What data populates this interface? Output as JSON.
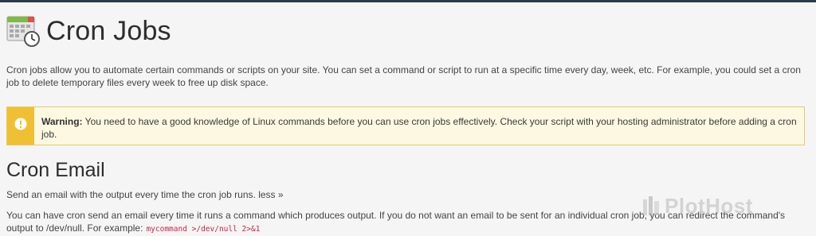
{
  "header": {
    "title": "Cron Jobs",
    "icon": "calendar-clock-icon"
  },
  "intro": {
    "text": "Cron jobs allow you to automate certain commands or scripts on your site. You can set a command or script to run at a specific time every day, week, etc. For example, you could set a cron job to delete temporary files every week to free up disk space."
  },
  "warning": {
    "icon": "exclamation-icon",
    "label": "Warning:",
    "text": " You need to have a good knowledge of Linux commands before you can use cron jobs effectively. Check your script with your hosting administrator before adding a cron job."
  },
  "email": {
    "title": "Cron Email",
    "description": "Send an email with the output every time the cron job runs.",
    "more_link": "less »",
    "note": "You can have cron send an email every time it runs a command which produces output. If you do not want an email to be sent for an individual cron job, you can redirect the command's output to /dev/null. For example:",
    "example_code": "mycommand >/dev/null 2>&1"
  },
  "watermark": {
    "text": "PlotHost"
  },
  "colors": {
    "warning_accent": "#f0c034",
    "warning_bg": "#fcf8e1",
    "code": "#c7254e",
    "topbar": "#2b3a48"
  }
}
